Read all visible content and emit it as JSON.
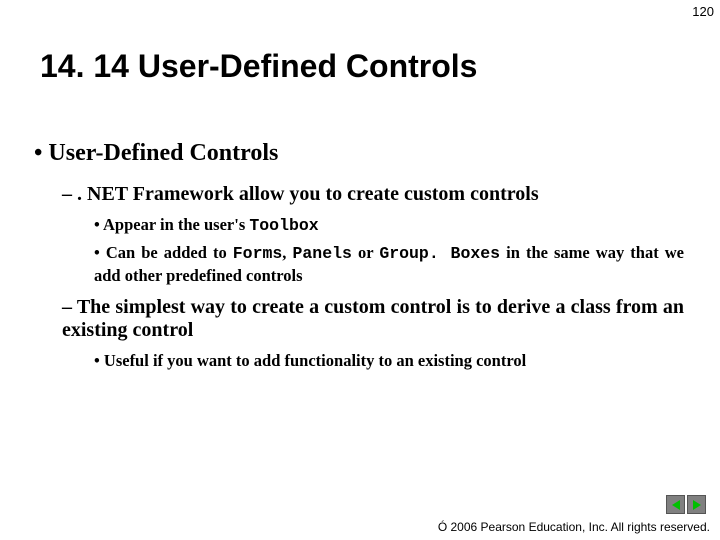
{
  "page_number": "120",
  "title": "14. 14 User-Defined Controls",
  "content": {
    "h1_bullet": "•",
    "h1_text": "User-Defined Controls",
    "sub1": {
      "dash": "–",
      "text": ". NET Framework allow you to create custom controls",
      "b1": {
        "bullet": "•",
        "pre": "Appear in the user's ",
        "code": "Toolbox"
      },
      "b2": {
        "bullet": "•",
        "t1": "Can be added to ",
        "c1": "Forms",
        "t2": ", ",
        "c2": "Panels",
        "t3": " or ",
        "c3": "Group. Boxes",
        "t4": " in the same way that we add other predefined controls"
      }
    },
    "sub2": {
      "dash": "–",
      "text": "The simplest way to create a custom control is to derive a class from an existing control",
      "b1": {
        "bullet": "•",
        "text": "Useful if you want to add functionality to an existing control"
      }
    }
  },
  "footer": {
    "copyright": "Ó",
    "text": " 2006 Pearson Education, Inc.  All rights reserved."
  }
}
